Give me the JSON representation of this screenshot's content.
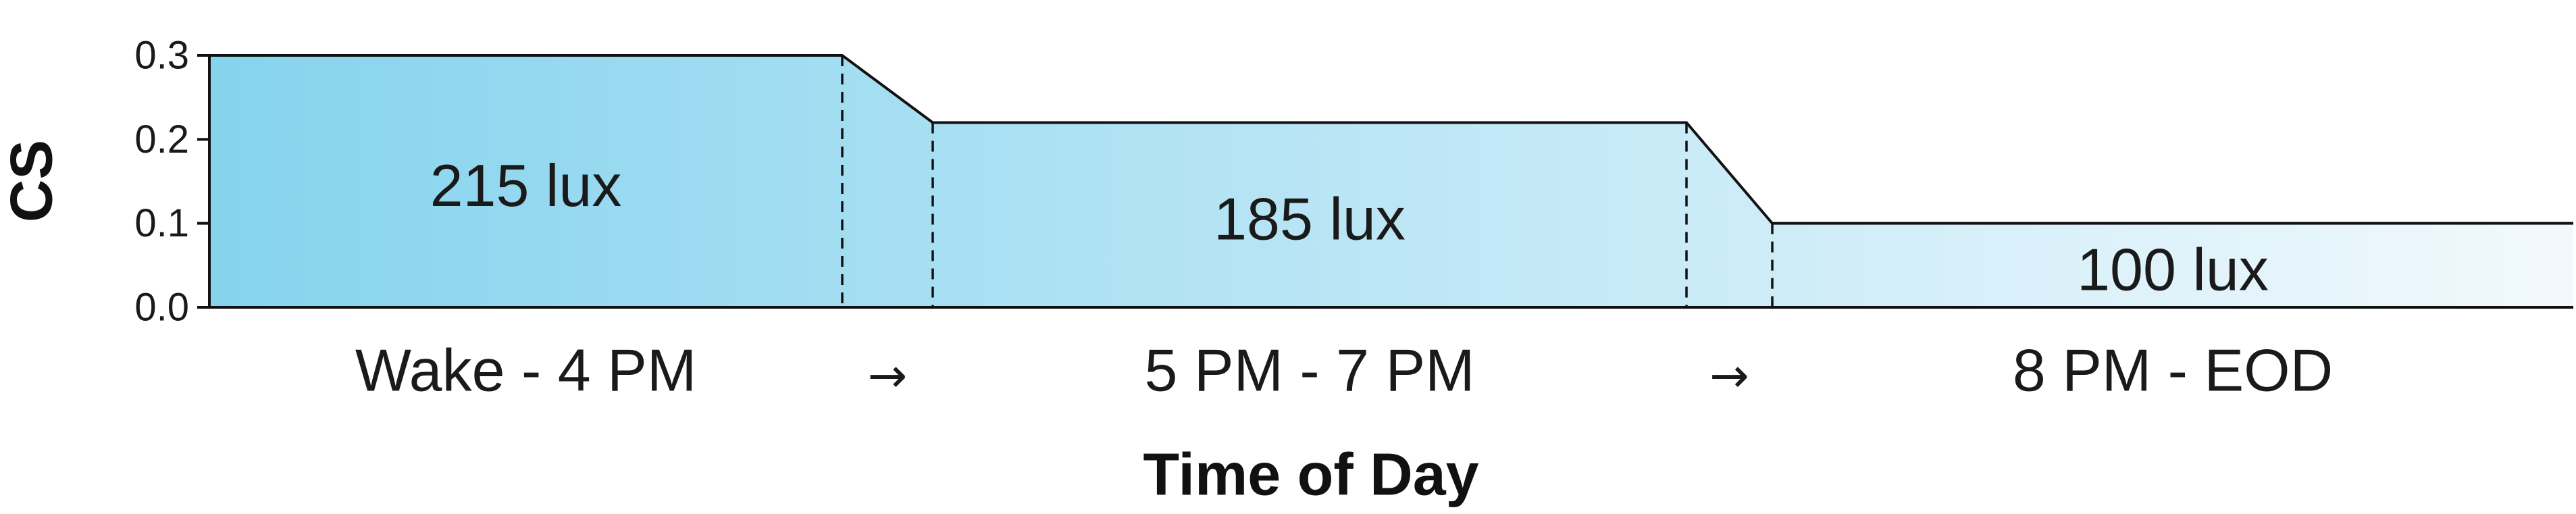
{
  "chart_data": {
    "type": "area",
    "title": "",
    "xlabel": "Time of Day",
    "ylabel": "CS",
    "ylim": [
      0,
      0.3
    ],
    "yticks": [
      "0.0",
      "0.1",
      "0.2",
      "0.3"
    ],
    "grid": false,
    "categories": [
      "Wake - 4 PM",
      "5 PM - 7 PM",
      "8 PM - EOD"
    ],
    "transition_marker": "→",
    "segments": [
      {
        "category": "Wake - 4 PM",
        "cs": 0.3,
        "label": "215 lux"
      },
      {
        "category": "5 PM - 7 PM",
        "cs": 0.22,
        "label": "185 lux"
      },
      {
        "category": "8 PM - EOD",
        "cs": 0.1,
        "label": "100 lux"
      }
    ],
    "colors": {
      "gradient_start": "#86d3ee",
      "gradient_end": "#f2f9fd",
      "line": "#111111"
    }
  }
}
